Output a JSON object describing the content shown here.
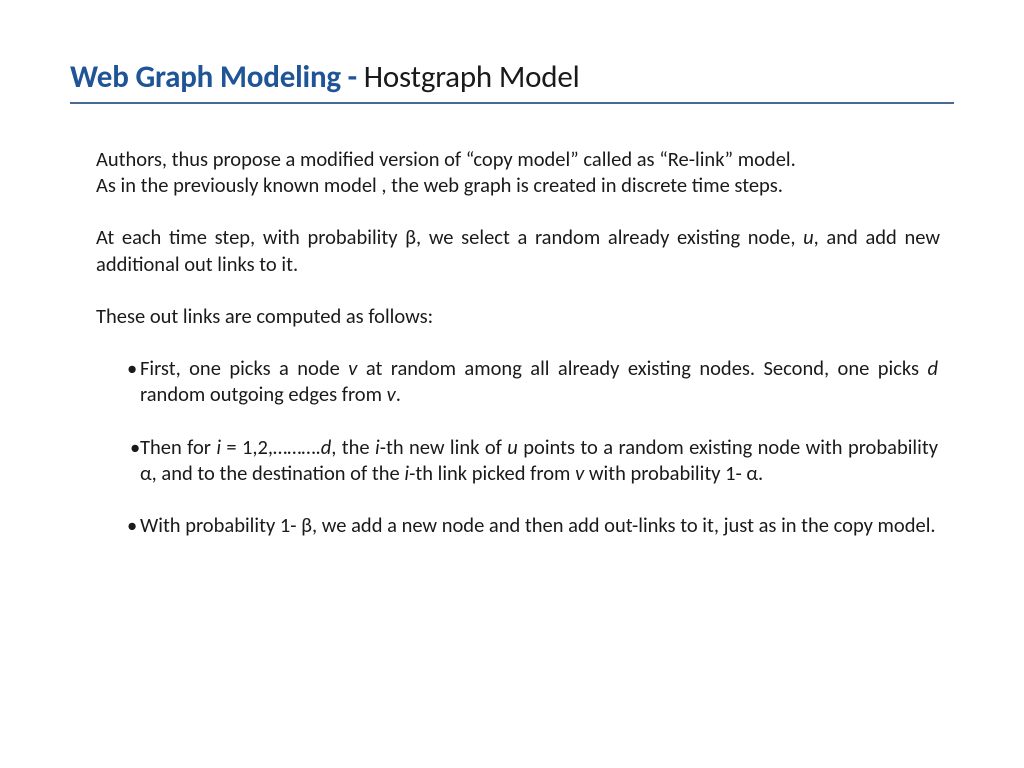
{
  "title": {
    "prefix": "Web Graph Modeling - ",
    "suffix": "Hostgraph Model"
  },
  "body": {
    "para1": "Authors, thus propose a modified version of “copy model” called as “Re-link” model.",
    "para2": "As in the previously known model , the web graph is created in discrete time steps.",
    "para3_pre": "At each time step, with probability β, we select a random already existing node, ",
    "para3_var": "u",
    "para3_post": ", and add new additional out links to it.",
    "para4": "These out links are computed as follows:",
    "bullet1_a": "First, one picks a node ",
    "bullet1_v": "v",
    "bullet1_b": " at random among all already existing nodes. Second, one picks ",
    "bullet1_d": "d",
    "bullet1_c": " random outgoing edges from ",
    "bullet1_v2": "v",
    "bullet1_end": ".",
    "bullet2_a": "Then for ",
    "bullet2_i1": "i",
    "bullet2_b": " = 1,2,……….",
    "bullet2_d": "d",
    "bullet2_c": ", the ",
    "bullet2_i2": "i",
    "bullet2_e": "-th new link of ",
    "bullet2_u": "u",
    "bullet2_f": " points to a random existing node with probability α, and to the destination of the ",
    "bullet2_i3": "i",
    "bullet2_g": "-th link picked from ",
    "bullet2_v": "v",
    "bullet2_h": " with probability 1- α.",
    "bullet3": " With probability 1- β, we add a new node and then add out-links to it, just as in the copy model."
  }
}
